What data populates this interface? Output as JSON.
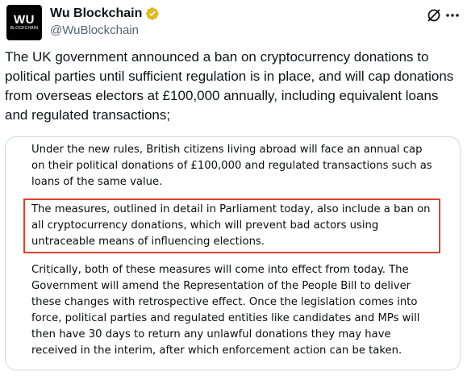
{
  "tweet": {
    "avatar_text": "WU",
    "avatar_subtext": "BLOCKCHAIN",
    "display_name": "Wu Blockchain",
    "handle": "@WuBlockchain",
    "text": "The UK government announced a ban on cryptocurrency donations to political parties until sufficient regulation is in place, and will cap donations from overseas electors at £100,000 annually, including equivalent loans and regulated transactions;"
  },
  "media": {
    "paragraph_1": "Under the new rules, British citizens living abroad will face an annual cap on their political donations of £100,000 and regulated transactions such as loans of the same value.",
    "paragraph_2": "The measures, outlined in detail in Parliament today, also include a ban on all cryptocurrency donations, which will prevent bad actors using untraceable means of influencing elections.",
    "paragraph_3": "Critically, both of these measures will come into effect from today. The Government will amend the Representation of the People Bill to deliver these changes with retrospective effect. Once the legislation comes into force, political parties and regulated entities like candidates and MPs will then have 30 days to return any unlawful donations they may have received in the interim, after which enforcement action can be taken."
  },
  "icons": {
    "verified": "verified-badge-icon",
    "grok": "grok-icon",
    "more": "more-options-icon"
  },
  "colors": {
    "verified_gold": "#e2b719",
    "highlight_border": "#d9432f",
    "handle_gray": "#536471",
    "text": "#0f1419"
  }
}
